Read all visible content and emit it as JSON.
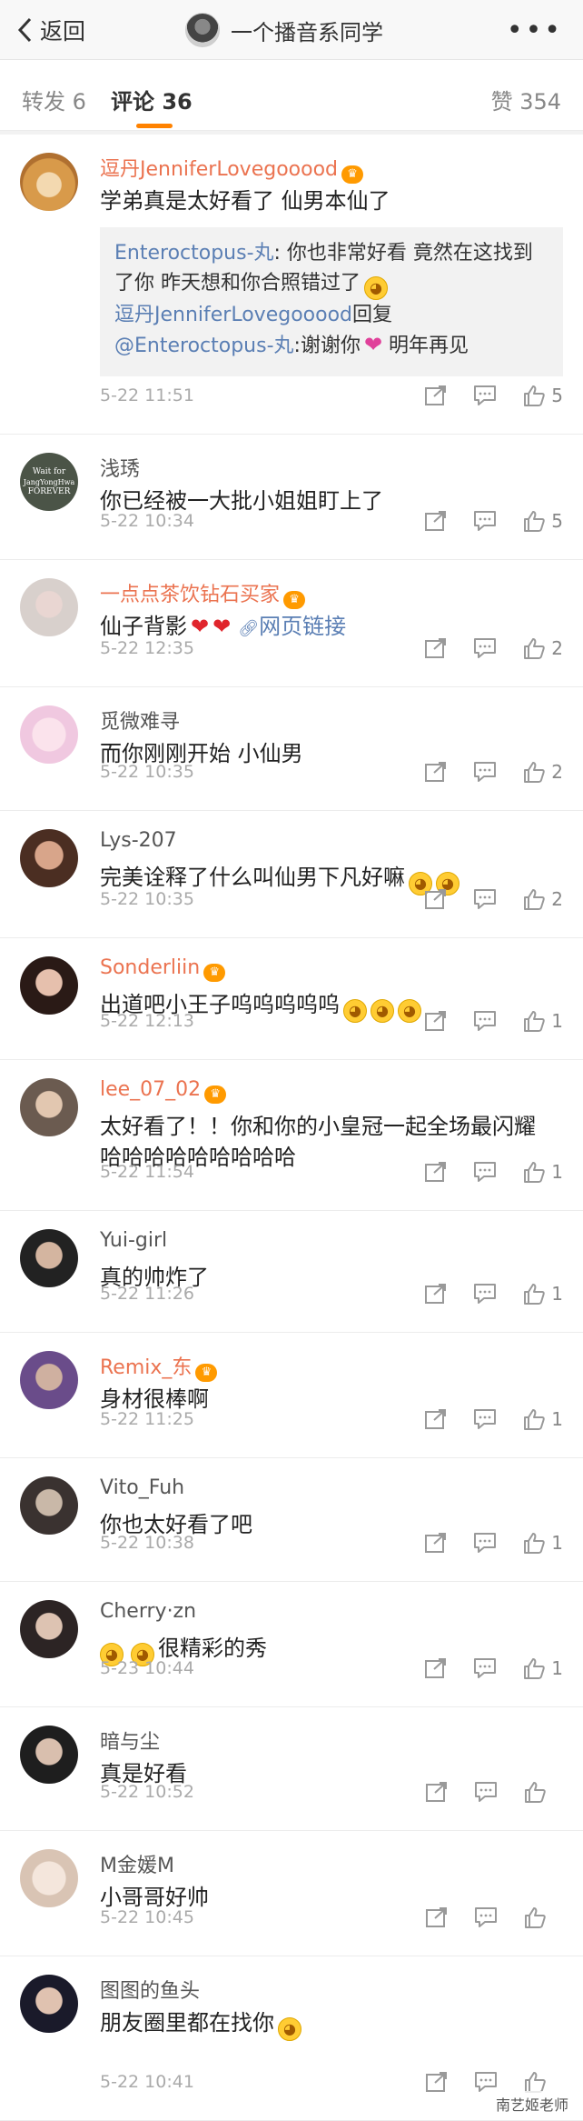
{
  "nav": {
    "back_label": "返回",
    "title": "一个播音系同学"
  },
  "tabs": {
    "repost": "转发 6",
    "comment": "评论 36",
    "like": "赞 354"
  },
  "colors": {
    "accent": "#ff8200",
    "vip_name": "#eb7350",
    "link": "#5b7fb4"
  },
  "comments": [
    {
      "name": "逗丹JenniferLovegooood",
      "text": "学弟真是太好看了 仙男本仙了",
      "time": "5-22 11:51",
      "likes": "5"
    },
    {
      "name": "浅琇",
      "text": "你已经被一大批小姐姐盯上了",
      "time": "5-22 10:34",
      "likes": "5"
    },
    {
      "name": "一点点茶饮钻石买家",
      "text": "仙子背影",
      "link": "网页链接",
      "time": "5-22 12:35",
      "likes": "2"
    },
    {
      "name": "觅微难寻",
      "text": "而你刚刚开始  小仙男",
      "time": "5-22 10:35",
      "likes": "2"
    },
    {
      "name": "Lys-207",
      "text": "完美诠释了什么叫仙男下凡好嘛",
      "time": "5-22 10:35",
      "likes": "2"
    },
    {
      "name": "Sonderliin",
      "text": "出道吧小王子呜呜呜呜呜",
      "time": "5-22 12:13",
      "likes": "1"
    },
    {
      "name": "lee_07_02",
      "text": "太好看了！！你和你的小皇冠一起全场最闪耀哈哈哈哈哈哈哈哈哈",
      "time": "5-22 11:54",
      "likes": "1"
    },
    {
      "name": "Yui-girl",
      "text": "真的帅炸了",
      "time": "5-22 11:26",
      "likes": "1"
    },
    {
      "name": "Remix_东",
      "text": "身材很棒啊",
      "time": "5-22 11:25",
      "likes": "1"
    },
    {
      "name": "Vito_Fuh",
      "text": "你也太好看了吧",
      "time": "5-22 10:38",
      "likes": "1"
    },
    {
      "name": "Cherry·zn",
      "text": "很精彩的秀",
      "time": "5-23 10:44",
      "likes": "1"
    },
    {
      "name": "暗与尘",
      "text": "真是好看",
      "time": "5-22 10:52",
      "likes": ""
    },
    {
      "name": "M金媛M",
      "text": "小哥哥好帅",
      "time": "5-22 10:45",
      "likes": ""
    },
    {
      "name": "图图的鱼头",
      "text": "朋友圈里都在找你",
      "time": "5-22 10:41",
      "likes": ""
    }
  ],
  "quote": {
    "line1_name": "Enteroctopus-丸",
    "line1_text": ": 你也非常好看 竟然在这找到了你 昨天想和你合照错过了",
    "line2_name": "逗丹JenniferLovegooood",
    "line2_text": "回复",
    "line3_name": "@Enteroctopus-丸",
    "line3_text": ":谢谢你",
    "line3_tail": " 明年再见"
  },
  "avatar_badge_text": [
    "Wait for",
    "JangYongHwa",
    "FOREVER"
  ],
  "watermark": "南艺姬老师"
}
